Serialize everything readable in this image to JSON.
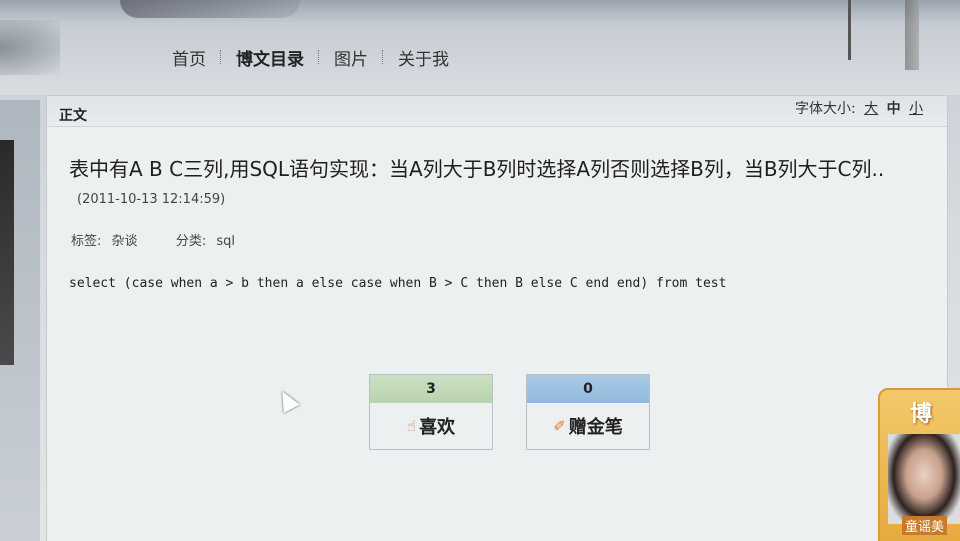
{
  "nav": {
    "items": [
      {
        "label": "首页"
      },
      {
        "label": "博文目录"
      },
      {
        "label": "图片"
      },
      {
        "label": "关于我"
      }
    ]
  },
  "panel": {
    "header_label": "正文",
    "font_size": {
      "label": "字体大小:",
      "large": "大",
      "medium": "中",
      "small": "小"
    }
  },
  "article": {
    "title": "表中有A B C三列,用SQL语句实现：当A列大于B列时选择A列否则选择B列，当B列大于C列..",
    "date": "(2011-10-13 12:14:59)",
    "tags_label": "标签:",
    "tag": "杂谈",
    "category_label": "分类:",
    "category": "sql",
    "body": "select (case when a > b then a else case when B > C then B else C end end) from test"
  },
  "actions": {
    "like": {
      "count": "3",
      "label": "喜欢"
    },
    "pen": {
      "count": "0",
      "label": "赠金笔"
    }
  },
  "ad": {
    "title": "博",
    "caption": "童谣美"
  }
}
